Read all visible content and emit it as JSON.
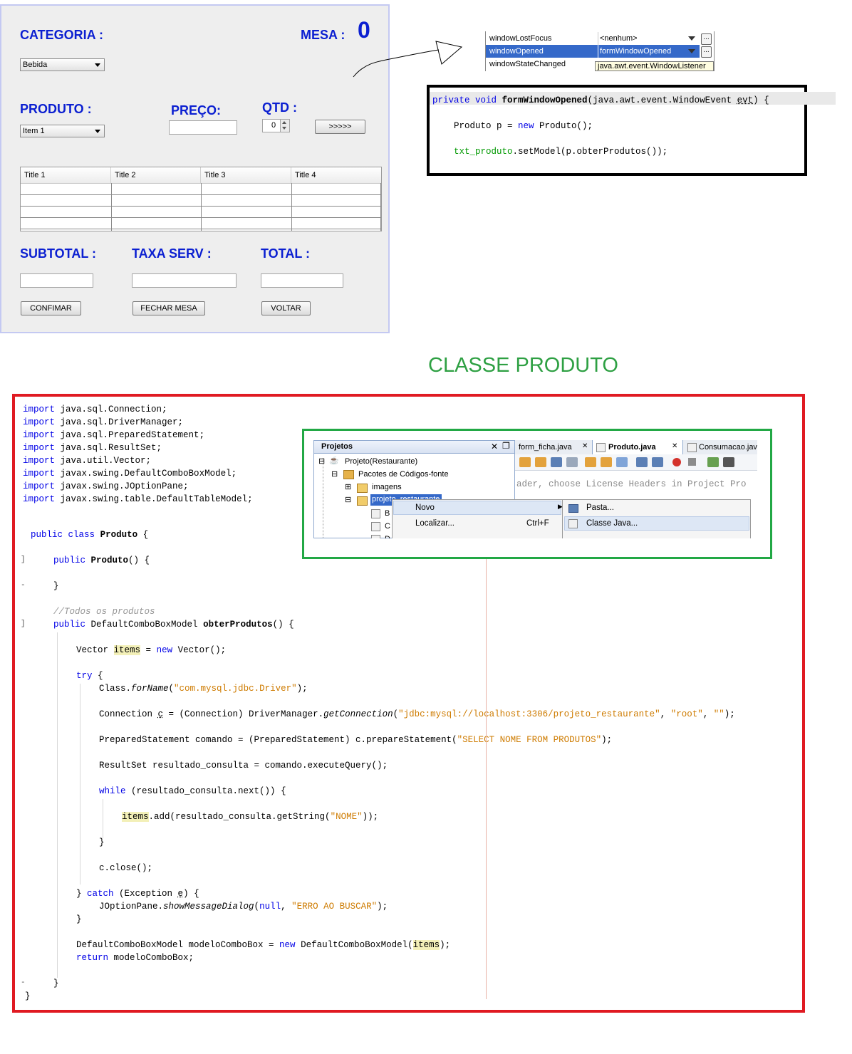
{
  "form": {
    "categoria_label": "CATEGORIA :",
    "mesa_label": "MESA :",
    "mesa_number": "0",
    "categoria_value": "Bebida",
    "produto_label": "PRODUTO :",
    "preco_label": "PREÇO:",
    "qtd_label": "QTD :",
    "produto_value": "Item 1",
    "qtd_value": "0",
    "add_button": ">>>>>",
    "table_headers": [
      "Title 1",
      "Title 2",
      "Title 3",
      "Title 4"
    ],
    "subtotal_label": "SUBTOTAL :",
    "taxa_label": "TAXA SERV :",
    "total_label": "TOTAL :",
    "confirmar_button": "CONFIMAR",
    "fechar_button": "FECHAR MESA",
    "voltar_button": "VOLTAR"
  },
  "events": {
    "rows": [
      {
        "name": "windowLostFocus",
        "value": "<nenhum>"
      },
      {
        "name": "windowOpened",
        "value": "formWindowOpened"
      },
      {
        "name": "windowStateChanged",
        "value": ""
      }
    ],
    "tooltip": "java.awt.event.WindowListener",
    "dots": "..."
  },
  "snippet": {
    "line1_kw": "private void ",
    "line1_method": "formWindowOpened",
    "line1_rest": "(java.awt.event.WindowEvent ",
    "line1_param": "evt",
    "line1_end": ") {",
    "line2_a": "    Produto p = ",
    "line2_kw": "new",
    "line2_b": " Produto();",
    "line3_field": "    txt_produto",
    "line3_rest": ".setModel(p.obterProdutos());"
  },
  "section_title": "CLASSE PRODUTO",
  "code": {
    "imports": [
      "java.sql.Connection;",
      "java.sql.DriverManager;",
      "java.sql.PreparedStatement;",
      "java.sql.ResultSet;",
      "java.util.Vector;",
      "javax.swing.DefaultComboBoxModel;",
      "javax.swing.JOptionPane;",
      "javax.swing.table.DefaultTableModel;"
    ],
    "import_kw": "import",
    "public": "public",
    "class": "class",
    "class_name": "Produto",
    "constructor": "Produto",
    "comment": "//Todos os produtos",
    "method_type": "DefaultComboBoxModel",
    "method_name": "obterProdutos",
    "vector_type": "Vector",
    "items": "items",
    "new": "new",
    "try": "try",
    "class_for": "Class.",
    "forName": "forName",
    "driver_str": "\"com.mysql.jdbc.Driver\"",
    "conn_a": "Connection ",
    "conn_c": "c",
    "conn_b": " = (Connection) DriverManager.",
    "getConnection": "getConnection",
    "url_str": "\"jdbc:mysql://localhost:3306/projeto_restaurante\"",
    "root_str": "\"root\"",
    "empty_str": "\"\"",
    "ps_a": "PreparedStatement comando = (PreparedStatement) c.prepareStatement(",
    "sql_str": "\"SELECT NOME FROM PRODUTOS\"",
    "rs_line": "ResultSet resultado_consulta = comando.executeQuery();",
    "while": "while",
    "while_rest": " (resultado_consulta.next()) {",
    "add_rest": ".add(resultado_consulta.getString(",
    "nome_str": "\"NOME\"",
    "close_line": "c.close();",
    "catch": "catch",
    "catch_rest": " (Exception ",
    "catch_e": "e",
    "joption": "JOptionPane.",
    "showMessageDialog": "showMessageDialog",
    "null": "null",
    "erro_str": "\"ERRO AO BUSCAR\"",
    "model_a": "DefaultComboBoxModel modeloComboBox = ",
    "model_b": " DefaultComboBoxModel(",
    "return": "return",
    "return_rest": " modeloComboBox;"
  },
  "ide": {
    "projects_title": "Projetos",
    "tabs": [
      "form_ficha.java",
      "Produto.java",
      "Consumacao.java"
    ],
    "tree": [
      "Projeto(Restaurante)",
      "Pacotes de Códigos-fonte",
      "imagens",
      "projeto_restaurante"
    ],
    "tree_children": [
      "B",
      "C",
      "D"
    ],
    "header_text": "ader, choose License Headers in Project Pro",
    "context_menu": [
      {
        "label": "Novo",
        "shortcut": ""
      },
      {
        "label": "Localizar...",
        "shortcut": "Ctrl+F"
      }
    ],
    "submenu": [
      "Pasta...",
      "Classe Java..."
    ]
  }
}
